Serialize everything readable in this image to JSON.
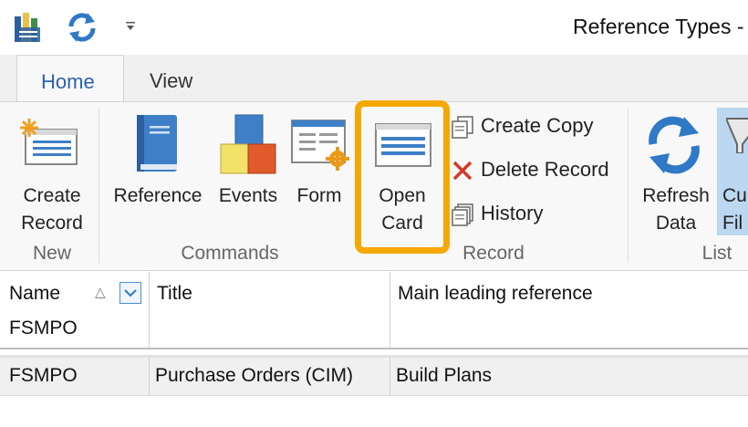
{
  "window": {
    "title": "Reference Types -"
  },
  "quick_access": {
    "icons": [
      "database-icon",
      "refresh-icon",
      "customize-arrow-icon"
    ]
  },
  "tabs": [
    {
      "label": "Home",
      "active": true
    },
    {
      "label": "View",
      "active": false
    }
  ],
  "ribbon": {
    "groups": {
      "new": {
        "label": "New",
        "create_record_line1": "Create",
        "create_record_line2": "Record"
      },
      "commands": {
        "label": "Commands",
        "reference": "Reference",
        "events": "Events",
        "form": "Form"
      },
      "record": {
        "label": "Record",
        "open_card_line1": "Open",
        "open_card_line2": "Card",
        "create_copy": "Create Copy",
        "delete_record": "Delete Record",
        "history": "History"
      },
      "list": {
        "label": "List",
        "refresh_line1": "Refresh",
        "refresh_line2": "Data",
        "customize_line1": "Cu",
        "customize_line2": "Fil"
      }
    }
  },
  "grid": {
    "columns": {
      "name": "Name",
      "title": "Title",
      "main_leading_reference": "Main leading reference"
    },
    "filter_value": "FSMPO",
    "rows": [
      {
        "name": "FSMPO",
        "title": "Purchase Orders (CIM)",
        "main_leading_reference": "Build Plans"
      }
    ]
  },
  "colors": {
    "accent": "#2a63a8",
    "highlight": "#f5a800",
    "selection": "#bcd7f0"
  }
}
